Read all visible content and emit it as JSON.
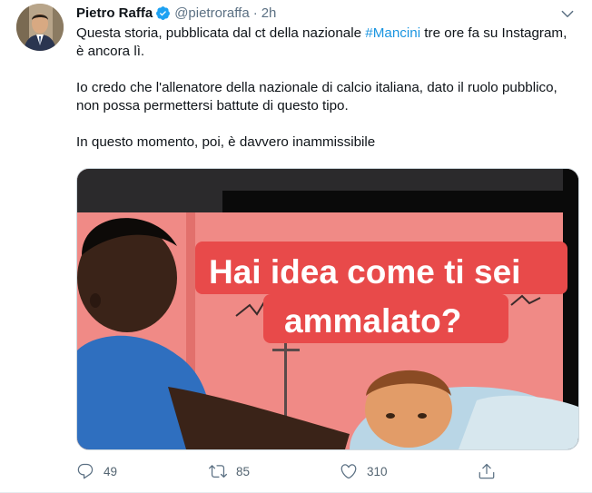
{
  "tweet": {
    "author_name": "Pietro Raffa",
    "handle": "@pietroraffa",
    "separator": "·",
    "time": "2h",
    "paragraph1_before": "Questa storia, pubblicata dal ct della nazionale ",
    "hashtag": "#Mancini",
    "paragraph1_after": " tre ore fa su Instagram, è ancora lì.",
    "paragraph2": "Io credo che l'allenatore della nazionale di calcio italiana, dato il ruolo pubblico, non possa permettersi battute di questo tipo.",
    "paragraph3": "In questo momento, poi, è davvero inammissibile",
    "media": {
      "caption_line1": "Hai idea come ti sei",
      "caption_line2": "ammalato?"
    },
    "actions": {
      "reply_count": "49",
      "retweet_count": "85",
      "like_count": "310"
    }
  },
  "icons": {
    "verified": "verified-badge-icon",
    "caret": "chevron-down-icon",
    "reply": "reply-icon",
    "retweet": "retweet-icon",
    "like": "heart-icon",
    "share": "share-icon"
  },
  "colors": {
    "link": "#1b95e0",
    "verified": "#1da1f2",
    "muted": "#5b7083",
    "caption_bg": "#e84a4a"
  }
}
